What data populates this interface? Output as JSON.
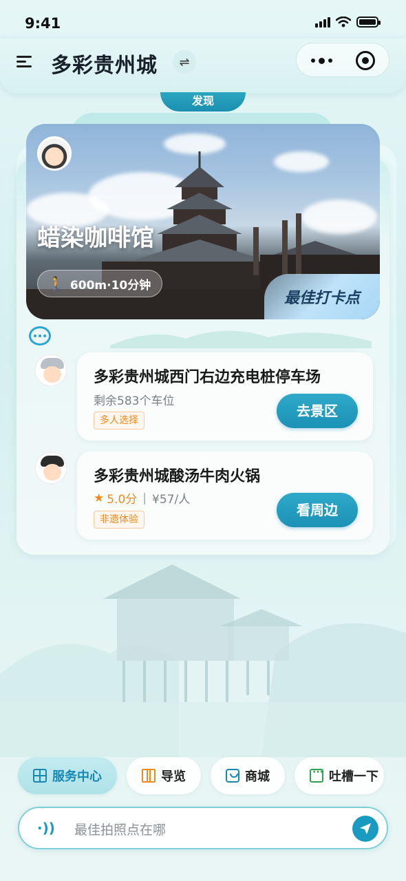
{
  "status_bar": {
    "time": "9:41"
  },
  "header": {
    "title": "多彩贵州城",
    "switch_glyph": "⇌",
    "menu_icon": "menu-icon",
    "more_icon": "more-dots-icon",
    "close_icon": "target-close-icon"
  },
  "discover_tab": {
    "label": "发现"
  },
  "hero": {
    "title": "蜡染咖啡馆",
    "distance": "600m·10分钟",
    "badge": "最佳打卡点",
    "walk_icon": "walking-person-icon"
  },
  "poi_list": [
    {
      "name": "多彩贵州城西门右边充电桩停车场",
      "subtitle": "剩余583个车位",
      "tag": "多人选择",
      "button": "去景区"
    },
    {
      "name": "多彩贵州城酸汤牛肉火锅",
      "rating": "5.0分",
      "rating_separator": "|",
      "price": "¥57/人",
      "tag": "非遗体验",
      "button": "看周边"
    }
  ],
  "quick_actions": [
    {
      "label": "服务中心",
      "icon": "grid-icon",
      "active": true
    },
    {
      "label": "导览",
      "icon": "map-icon",
      "active": false
    },
    {
      "label": "商城",
      "icon": "shopping-bag-icon",
      "active": false
    },
    {
      "label": "吐槽一下",
      "icon": "message-icon",
      "active": false
    }
  ],
  "input": {
    "placeholder": "最佳拍照点在哪"
  },
  "colors": {
    "accent": "#1b91b6",
    "tag_orange": "#f08a1c",
    "background": "#d4f0ef"
  }
}
